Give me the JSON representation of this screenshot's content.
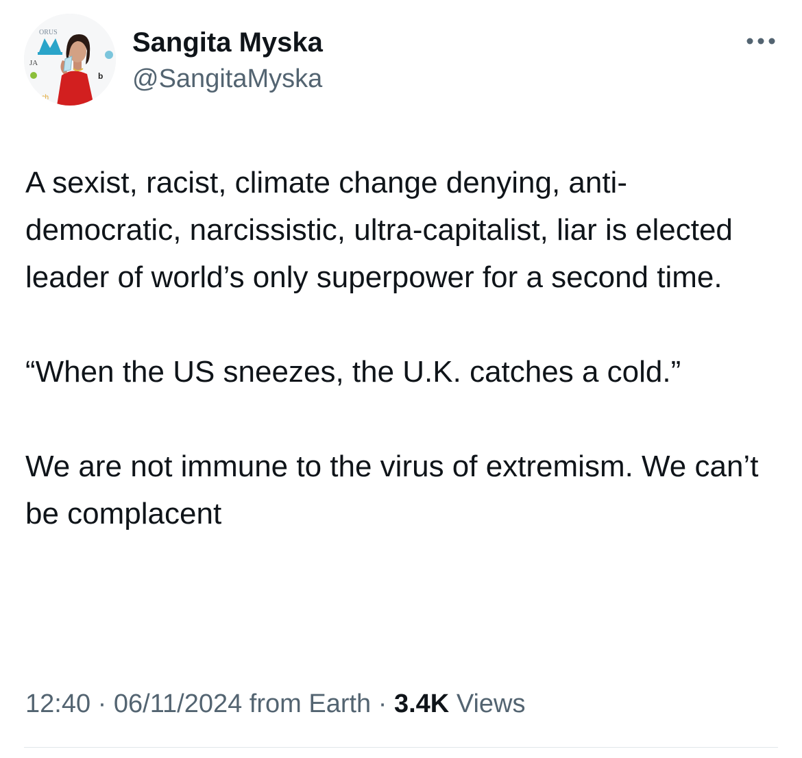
{
  "author": {
    "name": "Sangita Myska",
    "handle": "@SangitaMyska",
    "avatar_icon": "profile-photo"
  },
  "more_icon": "more-horizontal-icon",
  "tweet": {
    "paragraphs": [
      "A sexist, racist, climate change denying, anti-democratic, narcissistic, ultra-capitalist, liar is elected leader of world’s only superpower for a second time.",
      "“When the US sneezes, the U.K. catches a cold.”",
      "We are not immune to the virus of extremism. We can’t be complacent"
    ]
  },
  "meta": {
    "time": "12:40",
    "separator": " · ",
    "date": "06/11/2024",
    "source": " from Earth",
    "views_count": "3.4K",
    "views_label": " Views"
  },
  "colors": {
    "text_primary": "#0f1419",
    "text_secondary": "#536471",
    "divider": "#e1e6ea"
  }
}
